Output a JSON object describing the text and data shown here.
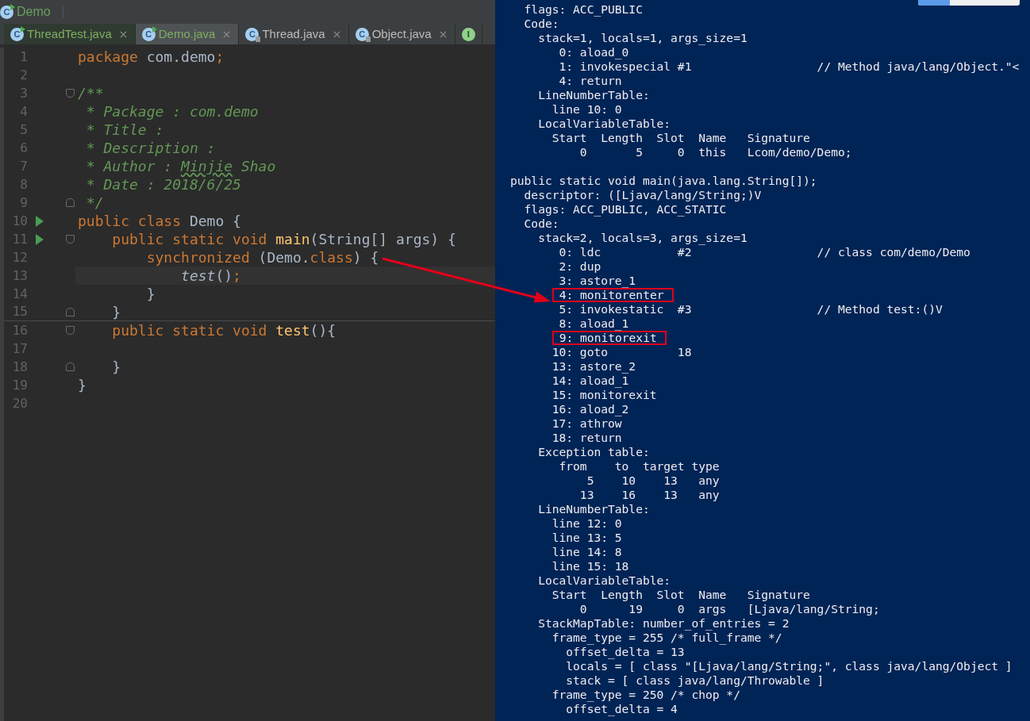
{
  "editor": {
    "breadcrumb": {
      "icon_letter": "C",
      "label": "Demo"
    },
    "tabs": [
      {
        "icon_letter": "C",
        "kind": "class-run",
        "label": "ThreadTest.java",
        "selected": false,
        "modified": true
      },
      {
        "icon_letter": "C",
        "kind": "class-run",
        "label": "Demo.java",
        "selected": true,
        "modified": true
      },
      {
        "icon_letter": "C",
        "kind": "class-locked",
        "label": "Thread.java",
        "selected": false,
        "modified": false
      },
      {
        "icon_letter": "C",
        "kind": "class-locked",
        "label": "Object.java",
        "selected": false,
        "modified": false
      },
      {
        "icon_letter": "I",
        "kind": "interface",
        "selected": false
      }
    ],
    "lines": [
      {
        "number": "1",
        "run": false,
        "fold_start": false,
        "fold_end": false,
        "current": false,
        "separator": false,
        "segments": [
          {
            "text": "package",
            "kind": "kw"
          },
          {
            "text": " com.demo",
            "kind": "plain"
          },
          {
            "text": ";",
            "kind": "kw"
          }
        ]
      },
      {
        "number": "2",
        "run": false,
        "fold_start": false,
        "fold_end": false,
        "current": false,
        "separator": false
      },
      {
        "number": "3",
        "run": false,
        "fold_start": true,
        "fold_end": false,
        "current": false,
        "separator": false,
        "segments": [
          {
            "text": "/**",
            "kind": "doc"
          }
        ]
      },
      {
        "number": "4",
        "run": false,
        "fold_start": false,
        "fold_end": false,
        "current": false,
        "separator": false,
        "segments": [
          {
            "text": " * Package : com.demo",
            "kind": "doc"
          }
        ]
      },
      {
        "number": "5",
        "run": false,
        "fold_start": false,
        "fold_end": false,
        "current": false,
        "separator": false,
        "segments": [
          {
            "text": " * Title :",
            "kind": "doc"
          }
        ]
      },
      {
        "number": "6",
        "run": false,
        "fold_start": false,
        "fold_end": false,
        "current": false,
        "separator": false,
        "segments": [
          {
            "text": " * Description :",
            "kind": "doc"
          }
        ]
      },
      {
        "number": "7",
        "run": false,
        "fold_start": false,
        "fold_end": false,
        "current": false,
        "separator": false,
        "segments": [
          {
            "text": " * Author : ",
            "kind": "doc"
          },
          {
            "text": "Minjie",
            "kind": "doc-typo"
          },
          {
            "text": " Shao",
            "kind": "doc"
          }
        ]
      },
      {
        "number": "8",
        "run": false,
        "fold_start": false,
        "fold_end": false,
        "current": false,
        "separator": false,
        "segments": [
          {
            "text": " * Date : 2018/6/25",
            "kind": "doc"
          }
        ]
      },
      {
        "number": "9",
        "run": false,
        "fold_start": false,
        "fold_end": true,
        "current": false,
        "separator": false,
        "segments": [
          {
            "text": " */",
            "kind": "doc"
          }
        ]
      },
      {
        "number": "10",
        "run": true,
        "fold_start": false,
        "fold_end": false,
        "current": false,
        "separator": false,
        "segments": [
          {
            "text": "public class",
            "kind": "kw"
          },
          {
            "text": " Demo {",
            "kind": "plain"
          }
        ]
      },
      {
        "number": "11",
        "run": true,
        "fold_start": true,
        "fold_end": false,
        "current": false,
        "separator": false,
        "segments": [
          {
            "text": "    public static void ",
            "kind": "kw"
          },
          {
            "text": "main",
            "kind": "method"
          },
          {
            "text": "(String[] args) {",
            "kind": "plain"
          }
        ]
      },
      {
        "number": "12",
        "run": false,
        "fold_start": false,
        "fold_end": false,
        "current": false,
        "separator": false,
        "segments": [
          {
            "text": "        synchronized",
            "kind": "kw"
          },
          {
            "text": " (Demo.",
            "kind": "plain"
          },
          {
            "text": "class",
            "kind": "kw"
          },
          {
            "text": ") {",
            "kind": "plain"
          }
        ]
      },
      {
        "number": "13",
        "run": false,
        "fold_start": false,
        "fold_end": false,
        "current": true,
        "separator": false,
        "segments": [
          {
            "text": "            test",
            "kind": "call"
          },
          {
            "text": "()",
            "kind": "plain"
          },
          {
            "text": ";",
            "kind": "kw"
          }
        ]
      },
      {
        "number": "14",
        "run": false,
        "fold_start": false,
        "fold_end": false,
        "current": false,
        "separator": false,
        "segments": [
          {
            "text": "        }",
            "kind": "plain"
          }
        ]
      },
      {
        "number": "15",
        "run": false,
        "fold_start": false,
        "fold_end": true,
        "current": false,
        "separator": true,
        "segments": [
          {
            "text": "    }",
            "kind": "plain"
          }
        ]
      },
      {
        "number": "16",
        "run": false,
        "fold_start": true,
        "fold_end": false,
        "current": false,
        "separator": false,
        "segments": [
          {
            "text": "    public static void ",
            "kind": "kw"
          },
          {
            "text": "test",
            "kind": "method"
          },
          {
            "text": "(){",
            "kind": "plain"
          }
        ]
      },
      {
        "number": "17",
        "run": false,
        "fold_start": false,
        "fold_end": false,
        "current": false,
        "separator": false
      },
      {
        "number": "18",
        "run": false,
        "fold_start": false,
        "fold_end": true,
        "current": false,
        "separator": false,
        "segments": [
          {
            "text": "    }",
            "kind": "plain"
          }
        ]
      },
      {
        "number": "19",
        "run": false,
        "fold_start": false,
        "fold_end": false,
        "current": false,
        "separator": false,
        "segments": [
          {
            "text": "}",
            "kind": "plain"
          }
        ]
      },
      {
        "number": "20",
        "run": false,
        "fold_start": false,
        "fold_end": false,
        "current": false,
        "separator": false
      }
    ]
  },
  "console": {
    "blocks": [
      {
        "lines": [
          {
            "text": "  flags: ACC_PUBLIC",
            "boxed": false
          },
          {
            "text": "  Code:",
            "boxed": false
          },
          {
            "text": "    stack=1, locals=1, args_size=1",
            "boxed": false
          },
          {
            "text": "       0: aload_0",
            "boxed": false
          },
          {
            "text": "       1: invokespecial #1                  // Method java/lang/Object.\"<",
            "boxed": false
          },
          {
            "text": "       4: return",
            "boxed": false
          },
          {
            "text": "    LineNumberTable:",
            "boxed": false
          },
          {
            "text": "      line 10: 0",
            "boxed": false
          },
          {
            "text": "    LocalVariableTable:",
            "boxed": false
          },
          {
            "text": "      Start  Length  Slot  Name   Signature",
            "boxed": false
          },
          {
            "text": "          0       5     0  this   Lcom/demo/Demo;",
            "boxed": false
          }
        ]
      },
      {
        "lines": [
          {
            "text": "public static void main(java.lang.String[]);",
            "boxed": false
          },
          {
            "text": "  descriptor: ([Ljava/lang/String;)V",
            "boxed": false
          },
          {
            "text": "  flags: ACC_PUBLIC, ACC_STATIC",
            "boxed": false
          },
          {
            "text": "  Code:",
            "boxed": false
          },
          {
            "text": "    stack=2, locals=3, args_size=1",
            "boxed": false
          },
          {
            "text": "       0: ldc           #2                  // class com/demo/Demo",
            "boxed": false
          },
          {
            "text": "       2: dup",
            "boxed": false
          },
          {
            "text": "       3: astore_1",
            "boxed": false
          },
          {
            "text": "       4: monitorenter",
            "boxed": true
          },
          {
            "text": "       5: invokestatic  #3                  // Method test:()V",
            "boxed": false
          },
          {
            "text": "       8: aload_1",
            "boxed": false
          },
          {
            "text": "       9: monitorexit",
            "boxed": true
          },
          {
            "text": "      10: goto          18",
            "boxed": false
          },
          {
            "text": "      13: astore_2",
            "boxed": false
          },
          {
            "text": "      14: aload_1",
            "boxed": false
          },
          {
            "text": "      15: monitorexit",
            "boxed": false
          },
          {
            "text": "      16: aload_2",
            "boxed": false
          },
          {
            "text": "      17: athrow",
            "boxed": false
          },
          {
            "text": "      18: return",
            "boxed": false
          },
          {
            "text": "    Exception table:",
            "boxed": false
          },
          {
            "text": "       from    to  target type",
            "boxed": false
          },
          {
            "text": "           5    10    13   any",
            "boxed": false
          },
          {
            "text": "          13    16    13   any",
            "boxed": false
          },
          {
            "text": "    LineNumberTable:",
            "boxed": false
          },
          {
            "text": "      line 12: 0",
            "boxed": false
          },
          {
            "text": "      line 13: 5",
            "boxed": false
          },
          {
            "text": "      line 14: 8",
            "boxed": false
          },
          {
            "text": "      line 15: 18",
            "boxed": false
          },
          {
            "text": "    LocalVariableTable:",
            "boxed": false
          },
          {
            "text": "      Start  Length  Slot  Name   Signature",
            "boxed": false
          },
          {
            "text": "          0      19     0  args   [Ljava/lang/String;",
            "boxed": false
          },
          {
            "text": "    StackMapTable: number_of_entries = 2",
            "boxed": false
          },
          {
            "text": "      frame_type = 255 /* full_frame */",
            "boxed": false
          },
          {
            "text": "        offset_delta = 13",
            "boxed": false
          },
          {
            "text": "        locals = [ class \"[Ljava/lang/String;\", class java/lang/Object ]",
            "boxed": false
          },
          {
            "text": "        stack = [ class java/lang/Throwable ]",
            "boxed": false
          },
          {
            "text": "      frame_type = 250 /* chop */",
            "boxed": false
          },
          {
            "text": "        offset_delta = 4",
            "boxed": false
          }
        ]
      }
    ]
  }
}
